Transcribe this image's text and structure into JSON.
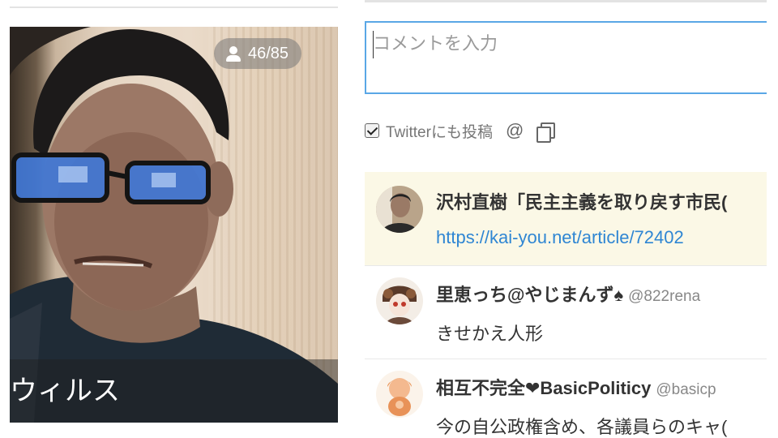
{
  "video": {
    "viewer_count": "46/85",
    "caption": "ウィルス"
  },
  "composer": {
    "placeholder": "コメントを入力",
    "twitter_checkbox_label": "Twitterにも投稿",
    "twitter_checked": true
  },
  "tweets": [
    {
      "name": "沢村直樹「民主主義を取り戻す市民(",
      "handle": "",
      "text": "https://kai-you.net/article/72402",
      "is_link": true
    },
    {
      "name": "里恵っち@やじまんず♠",
      "handle": "@822rena",
      "text": "きせかえ人形"
    },
    {
      "name": "相互不完全❤BasicPoliticy",
      "handle": "@basicp",
      "text": "今の自公政権含め、各議員らのキャ("
    }
  ],
  "colors": {
    "input_border": "#5aa7e6",
    "highlight_bg": "#fbf8e6",
    "link": "#2f86d3"
  }
}
